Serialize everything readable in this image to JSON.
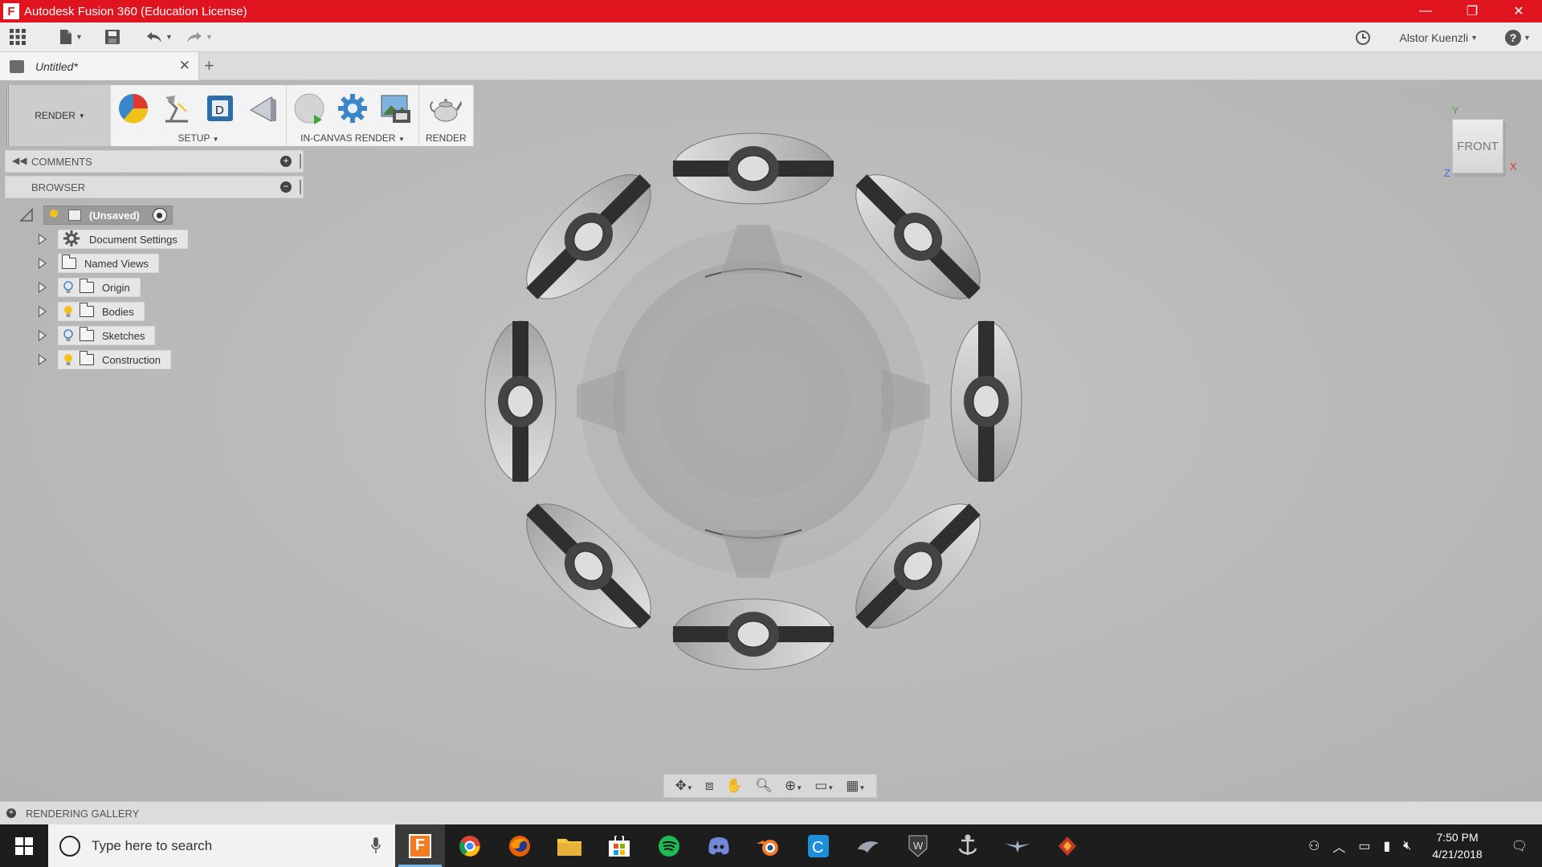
{
  "window": {
    "app_icon_letter": "F",
    "title": "Autodesk Fusion 360 (Education License)",
    "minimize": "—",
    "restore": "❐",
    "close": "✕"
  },
  "quick_access": {
    "user_name": "Alstor Kuenzli",
    "help_symbol": "?"
  },
  "document_tab": {
    "label": "Untitled*",
    "close": "✕",
    "new_tab": "+"
  },
  "toolbar": {
    "workspace_label": "RENDER",
    "panels": [
      {
        "label": "SETUP",
        "has_dropdown": true
      },
      {
        "label": "IN-CANVAS RENDER",
        "has_dropdown": true
      },
      {
        "label": "RENDER",
        "has_dropdown": false
      }
    ]
  },
  "comments_panel": {
    "label": "COMMENTS",
    "button": "+"
  },
  "browser_panel": {
    "label": "BROWSER",
    "button": "−",
    "root": {
      "label": "(Unsaved)"
    },
    "items": [
      {
        "label": "Document Settings",
        "icon": "gear-icon",
        "bulb": null
      },
      {
        "label": "Named Views",
        "icon": "folder-icon",
        "bulb": null
      },
      {
        "label": "Origin",
        "icon": "folder-icon",
        "bulb": "off"
      },
      {
        "label": "Bodies",
        "icon": "folder-icon",
        "bulb": "on"
      },
      {
        "label": "Sketches",
        "icon": "folder-icon",
        "bulb": "off"
      },
      {
        "label": "Construction",
        "icon": "folder-icon",
        "bulb": "on"
      }
    ]
  },
  "view_cube": {
    "face": "FRONT",
    "x_axis": "X",
    "y_axis": "Y",
    "z_axis": "Z"
  },
  "rendering_gallery": {
    "label": "RENDERING GALLERY",
    "button": "+"
  },
  "taskbar": {
    "search_placeholder": "Type here to search",
    "apps": [
      "fusion-360",
      "chrome",
      "firefox",
      "file-explorer",
      "store",
      "spotify",
      "discord",
      "blender",
      "ccleaner",
      "app-9",
      "world-of-tanks",
      "world-of-warships",
      "world-of-warplanes",
      "app-14"
    ],
    "time": "7:50 PM",
    "date": "4/21/2018"
  },
  "colors": {
    "title_bar": "#e0141f",
    "accent_blue": "#3b86c8",
    "taskbar": "#1d1d1d"
  }
}
